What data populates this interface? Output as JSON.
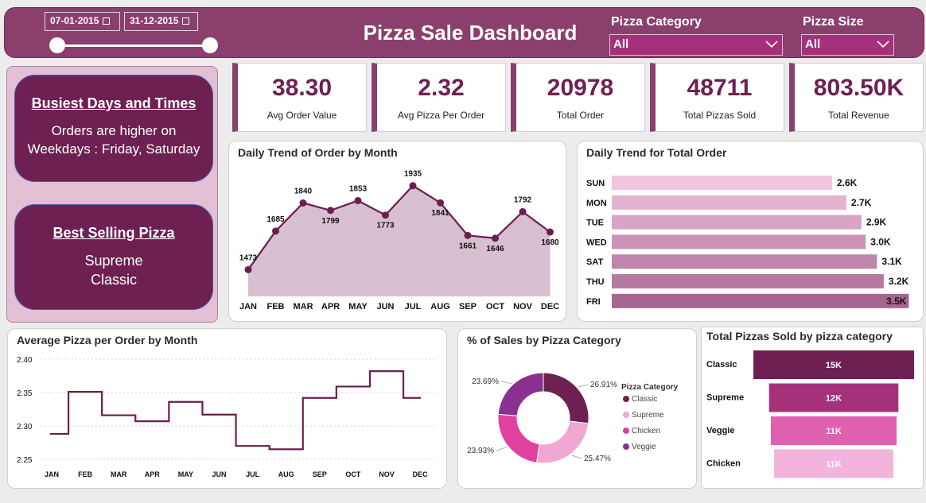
{
  "header": {
    "title": "Pizza Sale Dashboard",
    "date_start": "07-01-2015",
    "date_end": "31-12-2015",
    "category_label": "Pizza Category",
    "category_value": "All",
    "size_label": "Pizza Size",
    "size_value": "All"
  },
  "side": {
    "busiest_title": "Busiest Days and Times",
    "busiest_line1": "Orders are higher on",
    "busiest_line2": "Weekdays : Friday, Saturday",
    "best_title": "Best Selling Pizza",
    "best_line1": "Supreme",
    "best_line2": "Classic"
  },
  "kpis": [
    {
      "value": "38.30",
      "label": "Avg Order Value"
    },
    {
      "value": "2.32",
      "label": "Avg Pizza Per Order"
    },
    {
      "value": "20978",
      "label": "Total Order"
    },
    {
      "value": "48711",
      "label": "Total Pizzas Sold"
    },
    {
      "value": "803.50K",
      "label": "Total Revenue"
    }
  ],
  "colors": {
    "primary": "#8b3f6c",
    "dark": "#6e2052",
    "area_fill": "#d8bfd0",
    "line": "#6a1f4e"
  },
  "chart_data": [
    {
      "id": "monthly_orders",
      "type": "area",
      "title": "Daily Trend of Order by Month",
      "categories": [
        "JAN",
        "FEB",
        "MAR",
        "APR",
        "MAY",
        "JUN",
        "JUL",
        "AUG",
        "SEP",
        "OCT",
        "NOV",
        "DEC"
      ],
      "values": [
        1473,
        1685,
        1840,
        1799,
        1853,
        1773,
        1935,
        1841,
        1661,
        1646,
        1792,
        1680
      ],
      "data_labels": [
        "1473",
        "1685",
        "1840",
        "1799",
        "1853",
        "1773",
        "1935",
        "1841",
        "1661",
        "1646",
        "1792",
        "1680"
      ],
      "ylim": [
        1400,
        1960
      ]
    },
    {
      "id": "daily_orders",
      "type": "bar",
      "orientation": "horizontal",
      "title": "Daily Trend for Total Order",
      "categories": [
        "SUN",
        "MON",
        "TUE",
        "WED",
        "SAT",
        "THU",
        "FRI"
      ],
      "values": [
        2624,
        2794,
        2973,
        3024,
        3158,
        3239,
        3538
      ],
      "data_labels": [
        "2.6K",
        "2.7K",
        "2.9K",
        "3.0K",
        "3.1K",
        "3.2K",
        "3.5K"
      ],
      "colors": [
        "#f1c6e0",
        "#e3b3cf",
        "#d8a4c3",
        "#cb93b6",
        "#bf85aa",
        "#b7799f",
        "#a86590"
      ],
      "xlim": [
        0,
        3600
      ]
    },
    {
      "id": "avg_pizza_per_order",
      "type": "line",
      "step": true,
      "title": "Average Pizza per Order by Month",
      "categories": [
        "JAN",
        "FEB",
        "MAR",
        "APR",
        "MAY",
        "JUN",
        "JUL",
        "AUG",
        "SEP",
        "OCT",
        "NOV",
        "DEC"
      ],
      "values": [
        2.288,
        2.351,
        2.316,
        2.307,
        2.336,
        2.317,
        2.27,
        2.265,
        2.342,
        2.359,
        2.382,
        2.342
      ],
      "ylim": [
        2.25,
        2.4
      ],
      "yticks": [
        "2.25",
        "2.30",
        "2.35",
        "2.40"
      ],
      "grid": true
    },
    {
      "id": "sales_by_category",
      "type": "pie",
      "donut": true,
      "title": "% of Sales by Pizza Category",
      "legend_title": "Pizza Category",
      "legend_position": "right",
      "labels": [
        "Classic",
        "Supreme",
        "Chicken",
        "Veggie"
      ],
      "values": [
        26.91,
        25.47,
        23.93,
        23.69
      ],
      "value_labels": [
        "26.91%",
        "25.47%",
        "23.93%",
        "23.69%"
      ],
      "colors": [
        "#6e2052",
        "#f0a8d2",
        "#e040a0",
        "#8a3090"
      ]
    },
    {
      "id": "pizzas_by_category",
      "type": "bar",
      "funnel": true,
      "title": "Total Pizzas Sold by pizza category",
      "categories": [
        "Classic",
        "Supreme",
        "Veggie",
        "Chicken"
      ],
      "values": [
        14888,
        11987,
        11649,
        11050
      ],
      "data_labels": [
        "15K",
        "12K",
        "11K",
        "11K"
      ],
      "colors": [
        "#6e2052",
        "#a5317b",
        "#e060b0",
        "#f2b3dc"
      ]
    }
  ]
}
